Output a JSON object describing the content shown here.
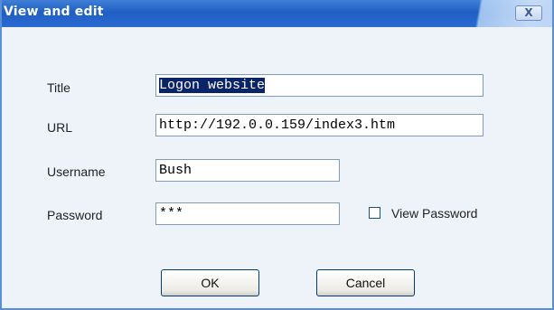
{
  "window": {
    "title": "View and edit",
    "close_label": "X"
  },
  "form": {
    "title_label": "Title",
    "title_value": "Logon website",
    "url_label": "URL",
    "url_value": "http://192.0.0.159/index3.htm",
    "username_label": "Username",
    "username_value": "Bush",
    "password_label": "Password",
    "password_value": "***",
    "view_password_label": "View Password",
    "view_password_checked": false
  },
  "buttons": {
    "ok_label": "OK",
    "cancel_label": "Cancel"
  },
  "colors": {
    "titlebar": "#1f5fc4",
    "window_bg": "#eef3fa",
    "selection": "#0a246a"
  }
}
